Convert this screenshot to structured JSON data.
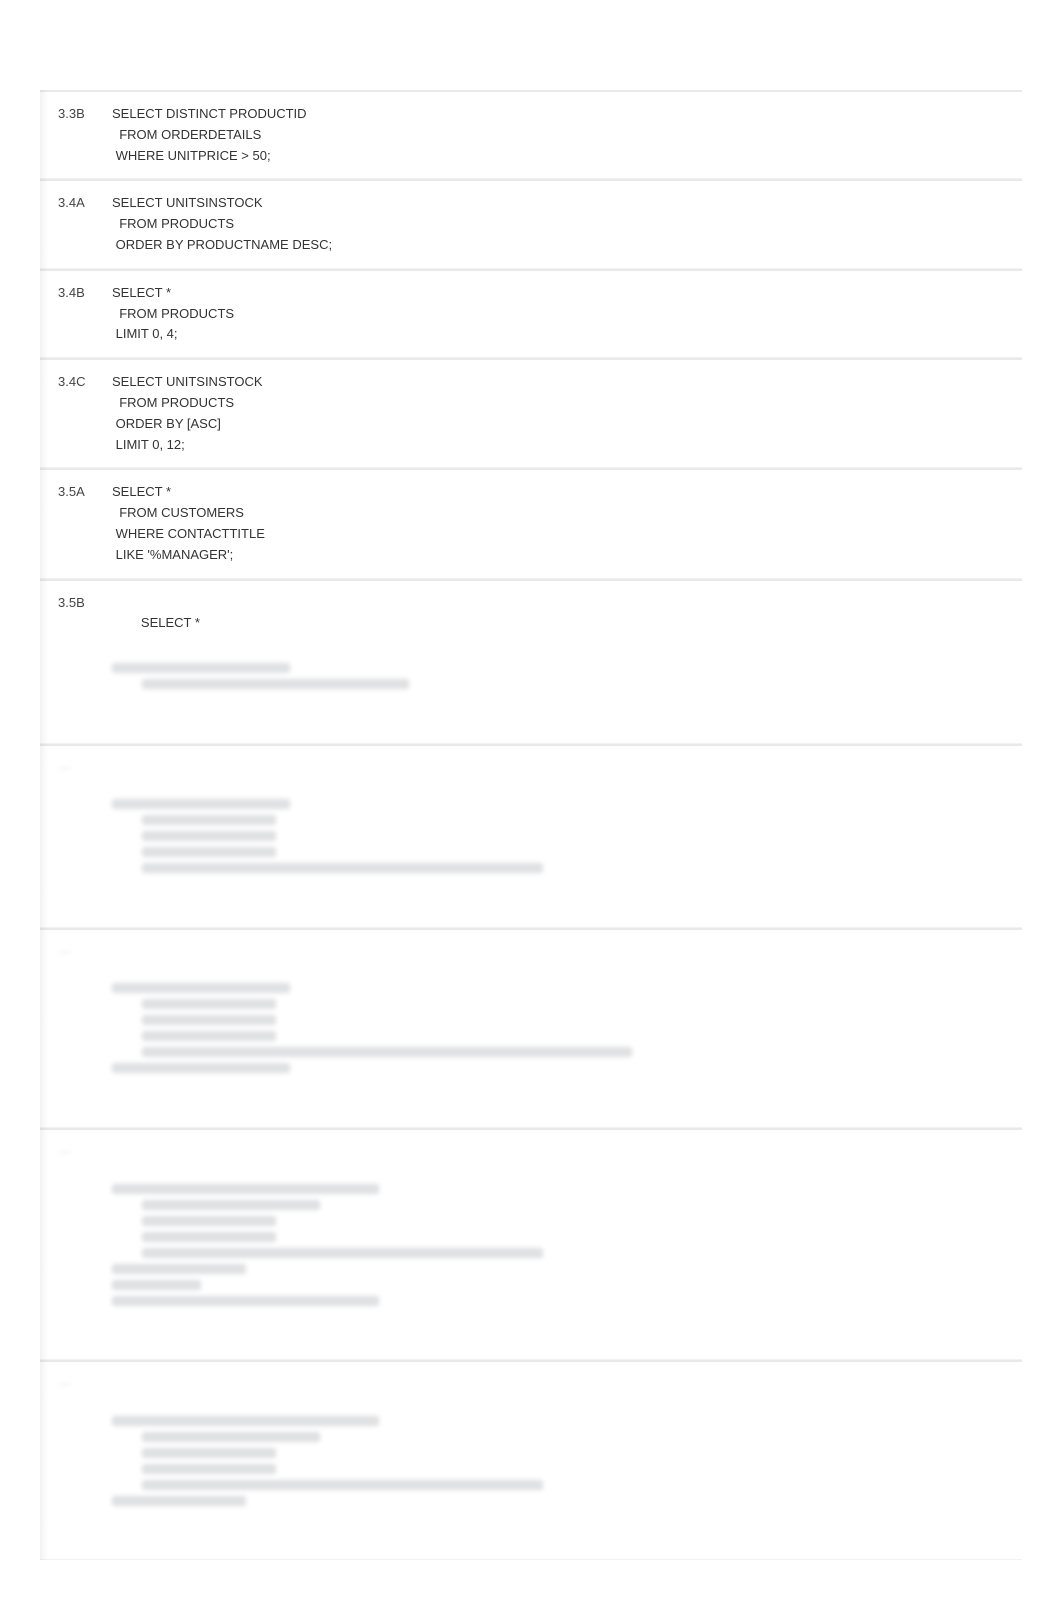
{
  "entries": [
    {
      "id": "3.3B",
      "code": "SELECT DISTINCT PRODUCTID\n  FROM ORDERDETAILS\n WHERE UNITPRICE > 50;"
    },
    {
      "id": "3.4A",
      "code": "SELECT UNITSINSTOCK\n  FROM PRODUCTS\n ORDER BY PRODUCTNAME DESC;"
    },
    {
      "id": "3.4B",
      "code": "SELECT *\n  FROM PRODUCTS\n LIMIT 0, 4;"
    },
    {
      "id": "3.4C",
      "code": "SELECT UNITSINSTOCK\n  FROM PRODUCTS\n ORDER BY [ASC]\n LIMIT 0, 12;"
    },
    {
      "id": "3.5A",
      "code": "SELECT *\n  FROM CUSTOMERS\n WHERE CONTACTTITLE\n LIKE '%MANAGER';"
    },
    {
      "id": "3.5B",
      "code": "SELECT *"
    }
  ],
  "blurred_rows": 4
}
